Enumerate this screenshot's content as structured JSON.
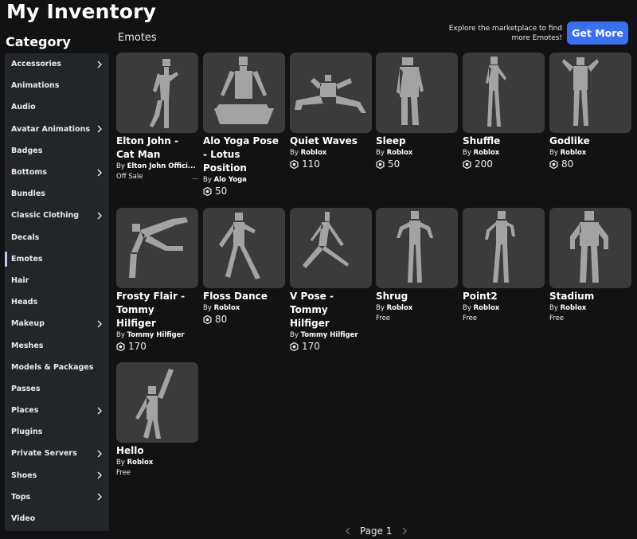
{
  "page_title": "My Inventory",
  "category_title": "Category",
  "section_title": "Emotes",
  "promo_text": "Explore the marketplace to find more Emotes!",
  "get_more_label": "Get More",
  "sidebar": {
    "items": [
      {
        "label": "Accessories",
        "chevron": true
      },
      {
        "label": "Animations",
        "chevron": false
      },
      {
        "label": "Audio",
        "chevron": false
      },
      {
        "label": "Avatar Animations",
        "chevron": true
      },
      {
        "label": "Badges",
        "chevron": false
      },
      {
        "label": "Bottoms",
        "chevron": true
      },
      {
        "label": "Bundles",
        "chevron": false
      },
      {
        "label": "Classic Clothing",
        "chevron": true
      },
      {
        "label": "Decals",
        "chevron": false
      },
      {
        "label": "Emotes",
        "chevron": false,
        "active": true
      },
      {
        "label": "Hair",
        "chevron": false
      },
      {
        "label": "Heads",
        "chevron": false
      },
      {
        "label": "Makeup",
        "chevron": true
      },
      {
        "label": "Meshes",
        "chevron": false
      },
      {
        "label": "Models & Packages",
        "chevron": false
      },
      {
        "label": "Passes",
        "chevron": false
      },
      {
        "label": "Places",
        "chevron": true
      },
      {
        "label": "Plugins",
        "chevron": false
      },
      {
        "label": "Private Servers",
        "chevron": true
      },
      {
        "label": "Shoes",
        "chevron": true
      },
      {
        "label": "Tops",
        "chevron": true
      },
      {
        "label": "Video",
        "chevron": false
      }
    ]
  },
  "items": [
    {
      "name": "Elton John - Cat Man",
      "by": "By",
      "creator": "Elton John Offici...",
      "status": "Off Sale",
      "more": "..."
    },
    {
      "name": "Alo Yoga Pose - Lotus Position",
      "by": "By",
      "creator": "Alo Yoga",
      "price": "50"
    },
    {
      "name": "Quiet Waves",
      "by": "By",
      "creator": "Roblox",
      "price": "110"
    },
    {
      "name": "Sleep",
      "by": "By",
      "creator": "Roblox",
      "price": "50"
    },
    {
      "name": "Shuffle",
      "by": "By",
      "creator": "Roblox",
      "price": "200"
    },
    {
      "name": "Godlike",
      "by": "By",
      "creator": "Roblox",
      "price": "80"
    },
    {
      "name": "Frosty Flair - Tommy Hilfiger",
      "by": "By",
      "creator": "Tommy Hilfiger",
      "price": "170"
    },
    {
      "name": "Floss Dance",
      "by": "By",
      "creator": "Roblox",
      "price": "80"
    },
    {
      "name": "V Pose - Tommy Hilfiger",
      "by": "By",
      "creator": "Tommy Hilfiger",
      "price": "170"
    },
    {
      "name": "Shrug",
      "by": "By",
      "creator": "Roblox",
      "status": "Free"
    },
    {
      "name": "Point2",
      "by": "By",
      "creator": "Roblox",
      "status": "Free"
    },
    {
      "name": "Stadium",
      "by": "By",
      "creator": "Roblox",
      "status": "Free"
    },
    {
      "name": "Hello",
      "by": "By",
      "creator": "Roblox",
      "status": "Free"
    }
  ],
  "pager": {
    "label": "Page 1"
  },
  "colors": {
    "background": "#121215",
    "sidebar": "#232629",
    "card": "#393b3d",
    "accent": "#3a6ff0",
    "figure": "#a3a3a3"
  }
}
